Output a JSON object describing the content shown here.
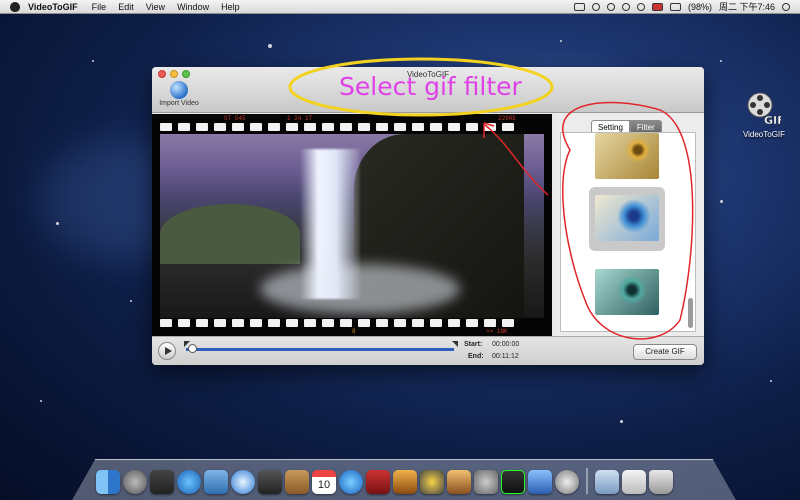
{
  "menubar": {
    "app_name": "VideoToGIF",
    "menus": [
      "File",
      "Edit",
      "View",
      "Window",
      "Help"
    ],
    "battery": "(98%)",
    "clock": "周二 下午7:46"
  },
  "desktop": {
    "icon_label": "VideoToGIF",
    "icon_overlay": "GIF"
  },
  "window": {
    "title": "VideoToGIF",
    "import_label": "Import Video",
    "tabs": {
      "setting": "Setting",
      "filter": "Filter"
    },
    "film_text": {
      "top_left": "ST   545",
      "top_mid": "1 24 1T",
      "top_right": "2290E",
      "bottom_mid": "8",
      "bottom_right": ">> 1NK"
    },
    "filters": [
      {
        "name": "sepia",
        "color": "#c8a14a",
        "selected": false
      },
      {
        "name": "blue",
        "color": "#3f8fd6",
        "selected": true
      },
      {
        "name": "cyan",
        "color": "#4fa8a0",
        "selected": false
      }
    ],
    "controls": {
      "start_label": "Start:",
      "start_value": "00:00:00",
      "end_label": "End:",
      "end_value": "00:11:12",
      "create_label": "Create GIF"
    }
  },
  "annotation": {
    "text": "Select gif filter",
    "color": "#e040e8",
    "stroke_colors": {
      "ellipse": "#f2d21f",
      "callout": "#e0262a"
    }
  },
  "dock": {
    "icons": [
      "finder-icon",
      "launchpad-icon",
      "mission-control-icon",
      "app-store-icon",
      "mail-icon",
      "safari-icon",
      "facetime-icon",
      "contacts-icon",
      "calendar-icon",
      "itunes-icon",
      "photobooth-icon",
      "iphoto-icon",
      "imovie-icon",
      "garageband-icon",
      "system-preferences-icon",
      "activity-monitor-icon",
      "xcode-icon",
      "videotogif-icon"
    ],
    "stack_icons": [
      "documents-icon",
      "downloads-icon",
      "trash-icon"
    ],
    "calendar_day": "10"
  }
}
